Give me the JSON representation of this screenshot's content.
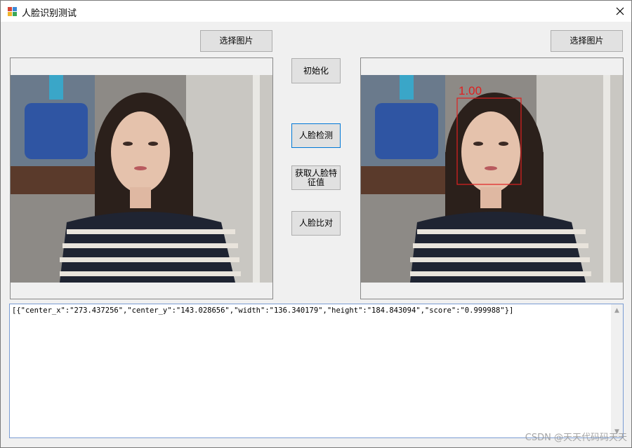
{
  "window": {
    "title": "人脸识别测试"
  },
  "buttons": {
    "select_left": "选择图片",
    "select_right": "选择图片",
    "init": "初始化",
    "detect": "人脸检测",
    "feature_line1": "获取人脸特",
    "feature_line2": "征值",
    "compare": "人脸比对"
  },
  "detection": {
    "score_label": "1.00",
    "box_color": "#e02020"
  },
  "output": {
    "text": "[{\"center_x\":\"273.437256\",\"center_y\":\"143.028656\",\"width\":\"136.340179\",\"height\":\"184.843094\",\"score\":\"0.999988\"}]"
  },
  "watermark": "CSDN @天天代码码天天",
  "icons": {
    "app": "app-icon",
    "close": "close-icon",
    "scroll_up": "scroll-up-arrow-icon",
    "scroll_down": "scroll-down-arrow-icon"
  }
}
